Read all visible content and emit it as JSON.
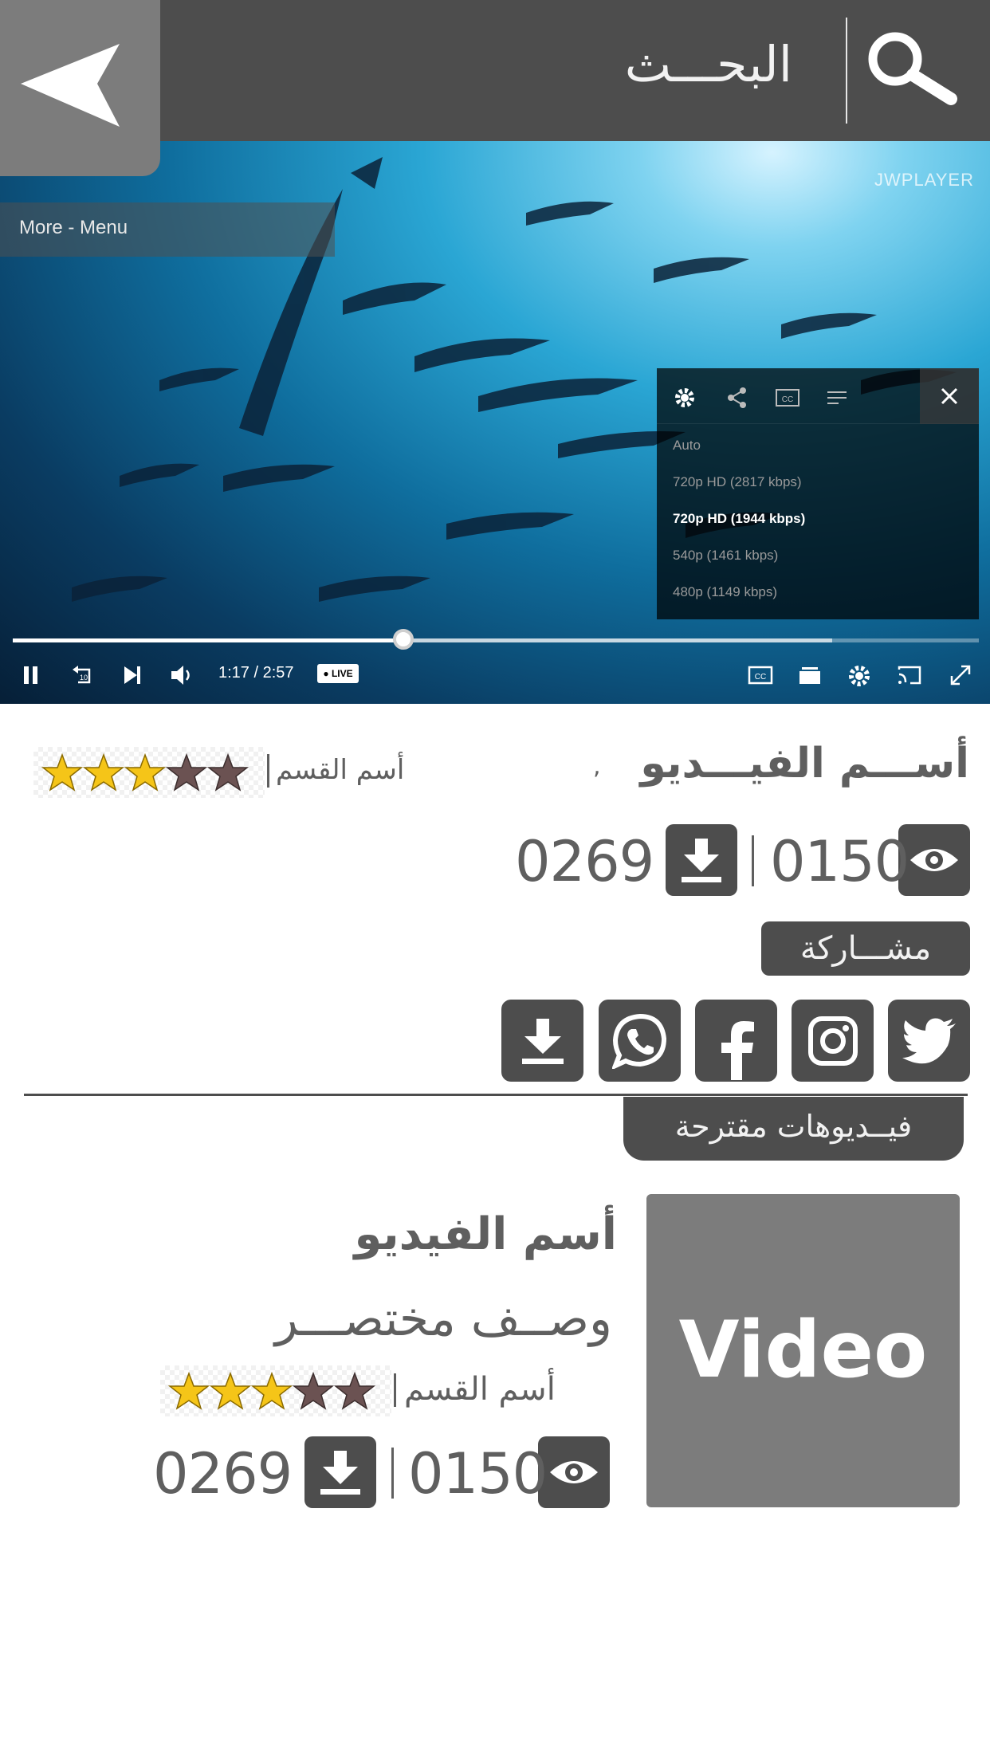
{
  "header": {
    "search_title": "البحـــث"
  },
  "player": {
    "logo_text": "JWPLAYER",
    "more_menu_label": "More - Menu",
    "quality_options": [
      {
        "label": "Auto",
        "selected": false
      },
      {
        "label": "720p HD (2817 kbps)",
        "selected": false
      },
      {
        "label": "720p HD (1944 kbps)",
        "selected": true
      },
      {
        "label": "540p (1461 kbps)",
        "selected": false
      },
      {
        "label": "480p (1149 kbps)",
        "selected": false
      }
    ],
    "time_display": "1:17 / 2:57",
    "live_label": "● LIVE",
    "progress": 0.404,
    "buffered": 0.848
  },
  "video": {
    "title": "أســـم الفيـــديو",
    "title_comma": ",",
    "category": "أسم القسم",
    "rating": 3,
    "rating_max": 5,
    "views": "0150",
    "downloads": "0269"
  },
  "share": {
    "label": "مشـــاركة",
    "buttons": [
      "twitter-icon",
      "instagram-icon",
      "facebook-icon",
      "whatsapp-icon",
      "download-icon"
    ]
  },
  "suggested": {
    "heading": "فيــديوهات مقترحة",
    "items": [
      {
        "thumbnail_text": "Video",
        "title": "أسم الفيديو",
        "description": "وصــف مختصـــر",
        "category": "أسم القسم",
        "rating": 3,
        "rating_max": 5,
        "views": "0150",
        "downloads": "0269"
      }
    ]
  },
  "colors": {
    "header_bg": "#4d4d4d",
    "back_button_bg": "#7c7c7c",
    "icon_box_bg": "#4d4d4d",
    "text": "#5f5f5f",
    "star_filled": "#f5c518",
    "star_empty": "#6b5252"
  }
}
